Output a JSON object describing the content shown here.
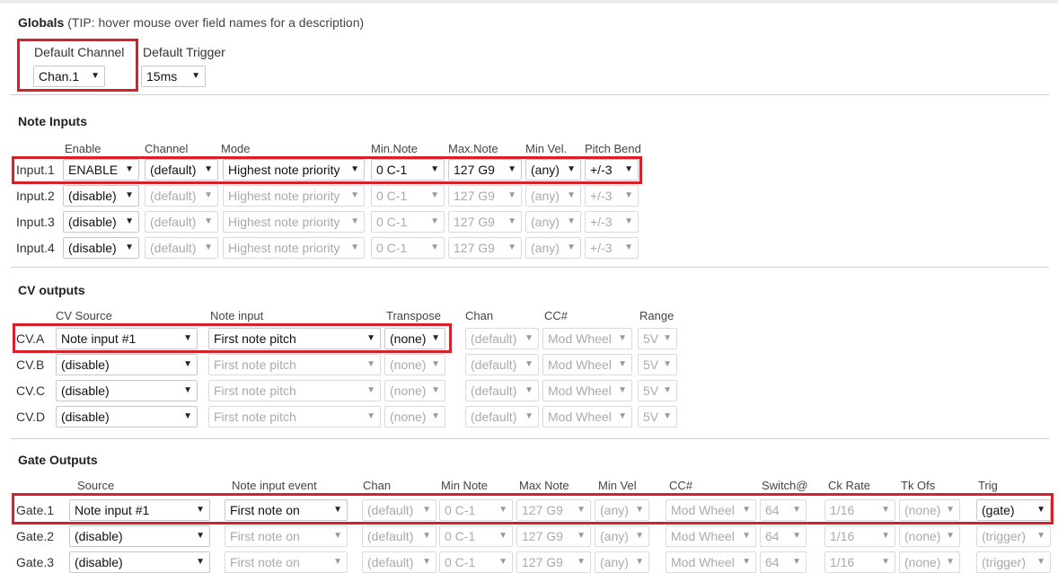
{
  "globals": {
    "title": "Globals",
    "tip": "(TIP: hover mouse over field names for a description)",
    "default_channel_label": "Default Channel",
    "default_channel_value": "Chan.1",
    "default_trigger_label": "Default Trigger",
    "default_trigger_value": "15ms"
  },
  "note_inputs": {
    "title": "Note Inputs",
    "headers": [
      "Enable",
      "Channel",
      "Mode",
      "Min.Note",
      "Max.Note",
      "Min Vel.",
      "Pitch Bend"
    ],
    "rows": [
      {
        "label": "Input.1",
        "enable": "ENABLE",
        "channel": "(default)",
        "mode": "Highest note priority",
        "min_note": "0 C-1",
        "max_note": "127 G9",
        "min_vel": "(any)",
        "pitch_bend": "+/-3"
      },
      {
        "label": "Input.2",
        "enable": "(disable)",
        "channel": "(default)",
        "mode": "Highest note priority",
        "min_note": "0 C-1",
        "max_note": "127 G9",
        "min_vel": "(any)",
        "pitch_bend": "+/-3"
      },
      {
        "label": "Input.3",
        "enable": "(disable)",
        "channel": "(default)",
        "mode": "Highest note priority",
        "min_note": "0 C-1",
        "max_note": "127 G9",
        "min_vel": "(any)",
        "pitch_bend": "+/-3"
      },
      {
        "label": "Input.4",
        "enable": "(disable)",
        "channel": "(default)",
        "mode": "Highest note priority",
        "min_note": "0 C-1",
        "max_note": "127 G9",
        "min_vel": "(any)",
        "pitch_bend": "+/-3"
      }
    ]
  },
  "cv_outputs": {
    "title": "CV outputs",
    "headers": [
      "CV Source",
      "Note input",
      "Transpose",
      "Chan",
      "CC#",
      "Range"
    ],
    "rows": [
      {
        "label": "CV.A",
        "source": "Note input #1",
        "note_input": "First note pitch",
        "transpose": "(none)",
        "chan": "(default)",
        "cc": "Mod Wheel",
        "range": "5V"
      },
      {
        "label": "CV.B",
        "source": "(disable)",
        "note_input": "First note pitch",
        "transpose": "(none)",
        "chan": "(default)",
        "cc": "Mod Wheel",
        "range": "5V"
      },
      {
        "label": "CV.C",
        "source": "(disable)",
        "note_input": "First note pitch",
        "transpose": "(none)",
        "chan": "(default)",
        "cc": "Mod Wheel",
        "range": "5V"
      },
      {
        "label": "CV.D",
        "source": "(disable)",
        "note_input": "First note pitch",
        "transpose": "(none)",
        "chan": "(default)",
        "cc": "Mod Wheel",
        "range": "5V"
      }
    ]
  },
  "gate_outputs": {
    "title": "Gate Outputs",
    "headers": [
      "Source",
      "Note input event",
      "Chan",
      "Min Note",
      "Max Note",
      "Min Vel",
      "CC#",
      "Switch@",
      "Ck Rate",
      "Tk Ofs",
      "Trig"
    ],
    "rows": [
      {
        "label": "Gate.1",
        "source": "Note input #1",
        "event": "First note on",
        "chan": "(default)",
        "min_note": "0 C-1",
        "max_note": "127 G9",
        "min_vel": "(any)",
        "cc": "Mod Wheel",
        "switch": "64",
        "ck_rate": "1/16",
        "tk_ofs": "(none)",
        "trig": "(gate)"
      },
      {
        "label": "Gate.2",
        "source": "(disable)",
        "event": "First note on",
        "chan": "(default)",
        "min_note": "0 C-1",
        "max_note": "127 G9",
        "min_vel": "(any)",
        "cc": "Mod Wheel",
        "switch": "64",
        "ck_rate": "1/16",
        "tk_ofs": "(none)",
        "trig": "(trigger)"
      },
      {
        "label": "Gate.3",
        "source": "(disable)",
        "event": "First note on",
        "chan": "(default)",
        "min_note": "0 C-1",
        "max_note": "127 G9",
        "min_vel": "(any)",
        "cc": "Mod Wheel",
        "switch": "64",
        "ck_rate": "1/16",
        "tk_ofs": "(none)",
        "trig": "(trigger)"
      }
    ]
  },
  "icons": {
    "dropdown_arrow": "chevron-down-icon"
  },
  "colors": {
    "highlight": "#d9202a",
    "disabled_text": "#aaaaaa"
  }
}
